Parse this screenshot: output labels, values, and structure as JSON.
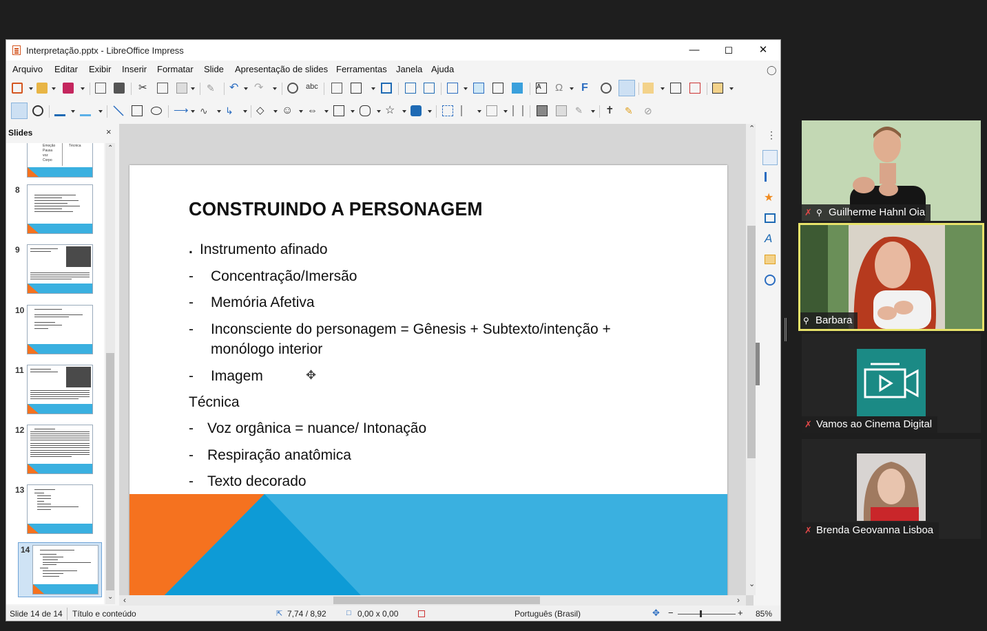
{
  "window": {
    "title": "Interpretação.pptx - LibreOffice Impress"
  },
  "menu": [
    "Arquivo",
    "Editar",
    "Exibir",
    "Inserir",
    "Formatar",
    "Slide",
    "Apresentação de slides",
    "Ferramentas",
    "Janela",
    "Ajuda"
  ],
  "panel": {
    "title": "Slides",
    "close": "×"
  },
  "thumbnails": [
    {
      "num": "8"
    },
    {
      "num": "9"
    },
    {
      "num": "10"
    },
    {
      "num": "11"
    },
    {
      "num": "12"
    },
    {
      "num": "13"
    },
    {
      "num": "14"
    }
  ],
  "thumb_top_partial": {
    "left_text": [
      "Emoção",
      "Pausa",
      "voz",
      "Corpo"
    ],
    "right_text": "Técnica"
  },
  "slide": {
    "title": "CONSTRUINDO A PERSONAGEM",
    "bullet_marker": ".",
    "bullet_1": "Instrumento afinado",
    "items_1": [
      "Concentração/Imersão",
      "Memória Afetiva",
      "Inconsciente do personagem = Gênesis + Subtexto/intenção +",
      "Imagem"
    ],
    "item_1_cont": "monólogo interior",
    "heading_2": "Técnica",
    "items_2": [
      "Voz orgânica = nuance/ Intonação",
      "Respiração anatômica",
      "Texto decorado"
    ],
    "dash": "-"
  },
  "status": {
    "slide": "Slide 14 de 14",
    "layout": "Título e conteúdo",
    "position": "7,74 / 8,92",
    "size": "0,00 x 0,00",
    "language": "Português (Brasil)",
    "zoom": "85%"
  },
  "participants": [
    {
      "name": "Guilherme Hahnl Oia",
      "muted": true,
      "pinned": true
    },
    {
      "name": "Barbara",
      "muted": false,
      "pinned": true,
      "active_speaker": true
    },
    {
      "name": "Vamos ao Cinema Digital",
      "muted": true,
      "pinned": false
    },
    {
      "name": "Brenda Geovanna Lisboa",
      "muted": true,
      "pinned": false
    }
  ],
  "colors": {
    "accent_orange": "#f5721f",
    "accent_blue": "#3ab0e0",
    "speaker_border": "#e8e36a",
    "teal_logo": "#1b8a85"
  }
}
